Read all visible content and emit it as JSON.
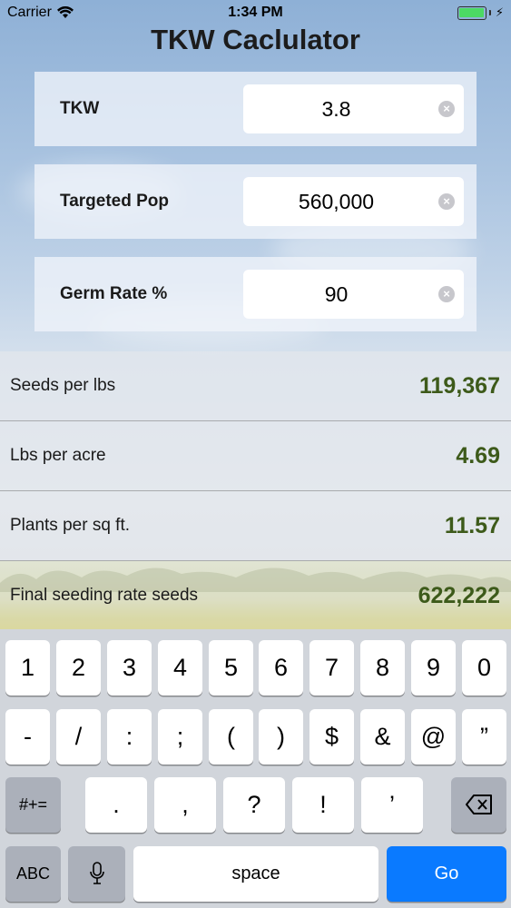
{
  "status_bar": {
    "carrier": "Carrier",
    "time": "1:34 PM",
    "battery_color": "#4cd964"
  },
  "app": {
    "title": "TKW Caclulator"
  },
  "inputs": [
    {
      "label": "TKW",
      "value": "3.8"
    },
    {
      "label": "Targeted Pop",
      "value": "560,000"
    },
    {
      "label": "Germ Rate %",
      "value": "90"
    }
  ],
  "results": [
    {
      "label": "Seeds per lbs",
      "value": "119,367"
    },
    {
      "label": "Lbs per acre",
      "value": "4.69"
    },
    {
      "label": "Plants per sq ft.",
      "value": "11.57"
    },
    {
      "label": "Final seeding rate seeds",
      "value": "622,222"
    }
  ],
  "keyboard": {
    "row1": [
      "1",
      "2",
      "3",
      "4",
      "5",
      "6",
      "7",
      "8",
      "9",
      "0"
    ],
    "row2": [
      "-",
      "/",
      ":",
      ";",
      "(",
      ")",
      "$",
      "&",
      "@",
      "”"
    ],
    "row3": [
      ".",
      ",",
      "?",
      "!",
      "’"
    ],
    "symbols_label": "#+=",
    "abc_label": "ABC",
    "space_label": "space",
    "go_label": "Go",
    "accent_color": "#0a7aff",
    "result_value_color": "#3d5a1a"
  }
}
